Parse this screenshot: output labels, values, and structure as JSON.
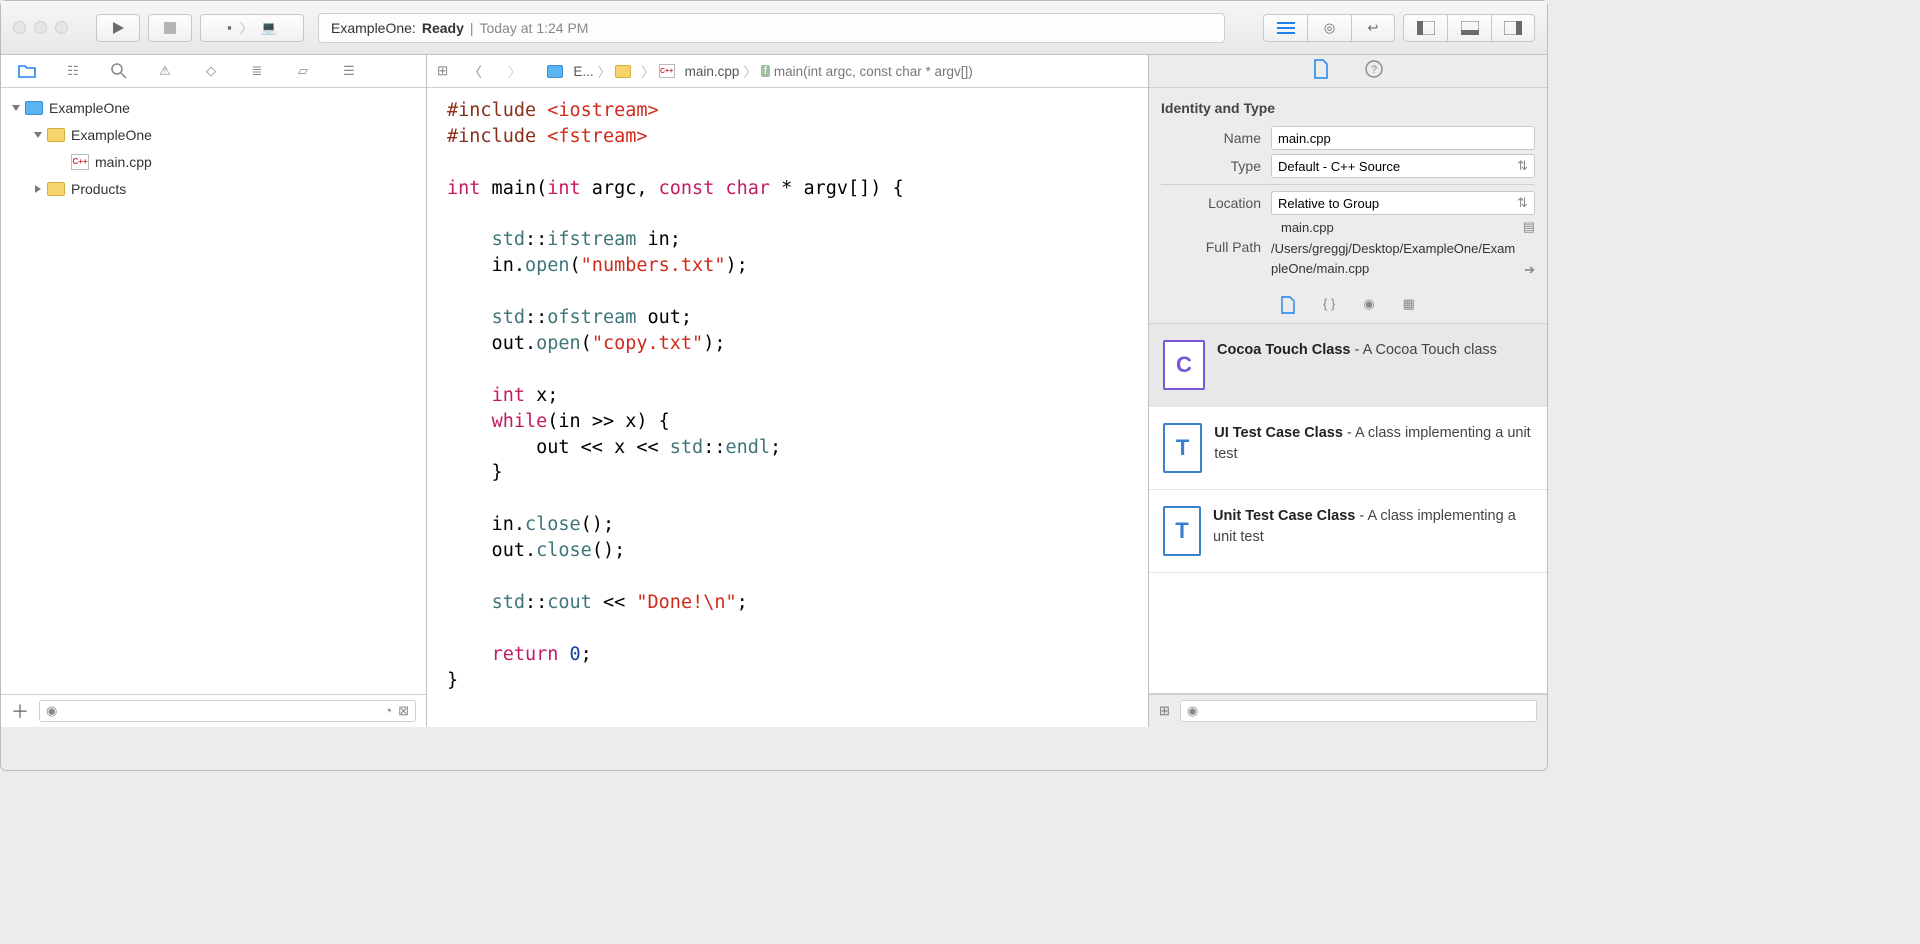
{
  "toolbar": {
    "status_project": "ExampleOne:",
    "status_state": "Ready",
    "status_sep": "|",
    "status_time": "Today at 1:24 PM"
  },
  "navigator": {
    "project": "ExampleOne",
    "folder": "ExampleOne",
    "file": "main.cpp",
    "products": "Products"
  },
  "jumpbar": {
    "proj_short": "E...",
    "file": "main.cpp",
    "symbol": "main(int argc, const char * argv[])"
  },
  "inspector": {
    "section": "Identity and Type",
    "name_label": "Name",
    "name_value": "main.cpp",
    "type_label": "Type",
    "type_value": "Default - C++ Source",
    "location_label": "Location",
    "location_value": "Relative to Group",
    "location_file": "main.cpp",
    "fullpath_label": "Full Path",
    "fullpath_value": "/Users/greggj/Desktop/ExampleOne/ExampleOne/main.cpp"
  },
  "library": [
    {
      "icon": "C",
      "title": "Cocoa Touch Class",
      "desc": " - A Cocoa Touch class",
      "selected": true
    },
    {
      "icon": "T",
      "title": "UI Test Case Class",
      "desc": " - A class implementing a unit test",
      "selected": false
    },
    {
      "icon": "T",
      "title": "Unit Test Case Class",
      "desc": " - A class implementing a unit test",
      "selected": false
    }
  ]
}
